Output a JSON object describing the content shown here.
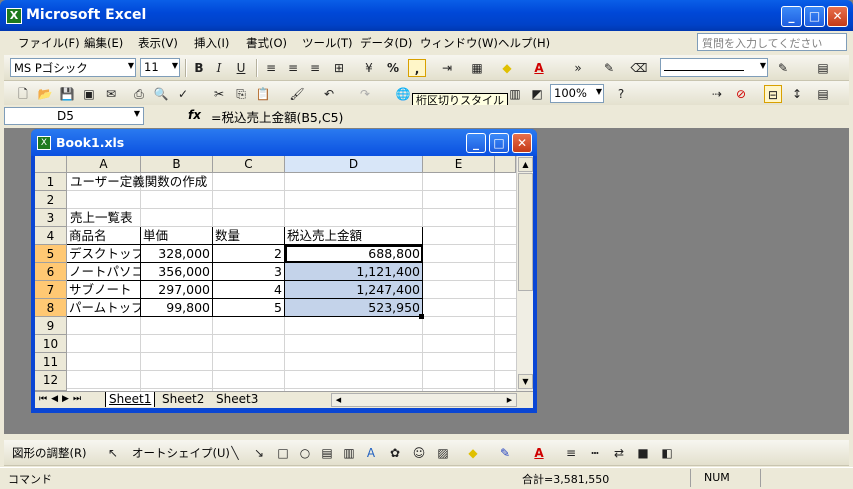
{
  "app": {
    "title": "Microsoft Excel",
    "icon": "excel-icon"
  },
  "menus": [
    "ファイル(F)",
    "編集(E)",
    "表示(V)",
    "挿入(I)",
    "書式(O)",
    "ツール(T)",
    "データ(D)",
    "ウィンドウ(W)",
    "ヘルプ(H)"
  ],
  "help_placeholder": "質問を入力してください",
  "format_toolbar": {
    "font": "MS Pゴシック",
    "size": "11",
    "bold": "B",
    "italic": "I",
    "underline": "U",
    "percent": "%",
    "comma": ","
  },
  "std_toolbar": {
    "zoom": "100%"
  },
  "tooltip": "桁区切りスタイル",
  "formula_bar": {
    "name_box": "D5",
    "fx": "fx",
    "formula": "=税込売上金額(B5,C5)"
  },
  "book": {
    "title": "Book1.xls"
  },
  "columns": [
    "A",
    "B",
    "C",
    "D",
    "E"
  ],
  "rows": [
    "1",
    "2",
    "3",
    "4",
    "5",
    "6",
    "7",
    "8",
    "9",
    "10",
    "11",
    "12"
  ],
  "cells": {
    "a1": "ユーザー定義関数の作成",
    "a3": "売上一覧表",
    "headers": [
      "商品名",
      "単価",
      "数量",
      "税込売上金額"
    ],
    "data": [
      [
        "デスクトップ",
        "328,000",
        "2",
        "688,800"
      ],
      [
        "ノートパソコン",
        "356,000",
        "3",
        "1,121,400"
      ],
      [
        "サブノート",
        "297,000",
        "4",
        "1,247,400"
      ],
      [
        "パームトップ",
        "99,800",
        "5",
        "523,950"
      ]
    ]
  },
  "sheets": [
    "Sheet1",
    "Sheet2",
    "Sheet3"
  ],
  "drawbar": {
    "draw": "図形の調整(R)",
    "autoshape": "オートシェイプ(U)"
  },
  "status": {
    "mode": "コマンド",
    "sum": "合計=3,581,550",
    "num": "NUM"
  },
  "colors": {
    "title_blue": "#0048d8",
    "selection": "#c4d3ea",
    "face": "#ece9d8"
  }
}
